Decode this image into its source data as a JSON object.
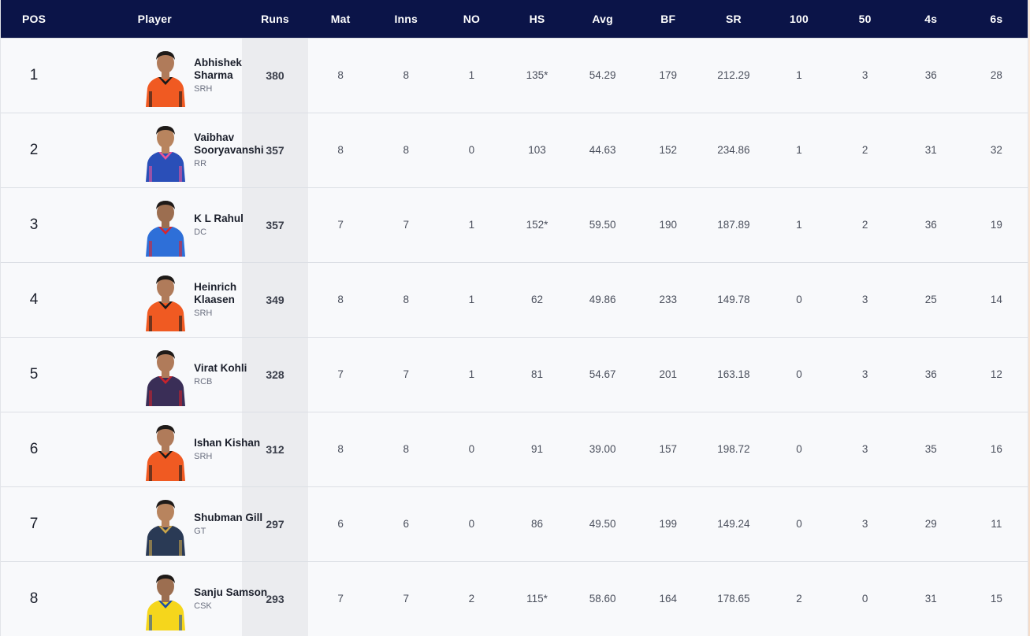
{
  "columns": [
    "POS",
    "Player",
    "Runs",
    "Mat",
    "Inns",
    "NO",
    "HS",
    "Avg",
    "BF",
    "SR",
    "100",
    "50",
    "4s",
    "6s"
  ],
  "team_colors": {
    "SRH": {
      "jersey": "#f05a22",
      "trim": "#1a1a1a",
      "skin": "#b07b5a"
    },
    "RR": {
      "jersey": "#2a4fb8",
      "trim": "#e8559a",
      "skin": "#b8845e"
    },
    "DC": {
      "jersey": "#2e6fd8",
      "trim": "#d8252f",
      "skin": "#9c6e50"
    },
    "RCB": {
      "jersey": "#3a2e57",
      "trim": "#c8232c",
      "skin": "#b07b5a"
    },
    "GT": {
      "jersey": "#2a3a55",
      "trim": "#c9a44a",
      "skin": "#b8845e"
    },
    "CSK": {
      "jersey": "#f5d61c",
      "trim": "#1f4fa3",
      "skin": "#9c6e50"
    }
  },
  "rows": [
    {
      "pos": "1",
      "name": "Abhishek Sharma",
      "team": "SRH",
      "runs": "380",
      "mat": "8",
      "inns": "8",
      "no": "1",
      "hs": "135*",
      "avg": "54.29",
      "bf": "179",
      "sr": "212.29",
      "hundreds": "1",
      "fifties": "3",
      "fours": "36",
      "sixes": "28",
      "avatar_icon": "player-photo-icon"
    },
    {
      "pos": "2",
      "name": "Vaibhav Sooryavanshi",
      "team": "RR",
      "runs": "357",
      "mat": "8",
      "inns": "8",
      "no": "0",
      "hs": "103",
      "avg": "44.63",
      "bf": "152",
      "sr": "234.86",
      "hundreds": "1",
      "fifties": "2",
      "fours": "31",
      "sixes": "32",
      "avatar_icon": "player-photo-icon"
    },
    {
      "pos": "3",
      "name": "K L Rahul",
      "team": "DC",
      "runs": "357",
      "mat": "7",
      "inns": "7",
      "no": "1",
      "hs": "152*",
      "avg": "59.50",
      "bf": "190",
      "sr": "187.89",
      "hundreds": "1",
      "fifties": "2",
      "fours": "36",
      "sixes": "19",
      "avatar_icon": "player-photo-icon"
    },
    {
      "pos": "4",
      "name": "Heinrich Klaasen",
      "team": "SRH",
      "runs": "349",
      "mat": "8",
      "inns": "8",
      "no": "1",
      "hs": "62",
      "avg": "49.86",
      "bf": "233",
      "sr": "149.78",
      "hundreds": "0",
      "fifties": "3",
      "fours": "25",
      "sixes": "14",
      "avatar_icon": "player-photo-icon"
    },
    {
      "pos": "5",
      "name": "Virat Kohli",
      "team": "RCB",
      "runs": "328",
      "mat": "7",
      "inns": "7",
      "no": "1",
      "hs": "81",
      "avg": "54.67",
      "bf": "201",
      "sr": "163.18",
      "hundreds": "0",
      "fifties": "3",
      "fours": "36",
      "sixes": "12",
      "avatar_icon": "player-photo-icon"
    },
    {
      "pos": "6",
      "name": "Ishan Kishan",
      "team": "SRH",
      "runs": "312",
      "mat": "8",
      "inns": "8",
      "no": "0",
      "hs": "91",
      "avg": "39.00",
      "bf": "157",
      "sr": "198.72",
      "hundreds": "0",
      "fifties": "3",
      "fours": "35",
      "sixes": "16",
      "avatar_icon": "player-photo-icon"
    },
    {
      "pos": "7",
      "name": "Shubman Gill",
      "team": "GT",
      "runs": "297",
      "mat": "6",
      "inns": "6",
      "no": "0",
      "hs": "86",
      "avg": "49.50",
      "bf": "199",
      "sr": "149.24",
      "hundreds": "0",
      "fifties": "3",
      "fours": "29",
      "sixes": "11",
      "avatar_icon": "player-photo-icon"
    },
    {
      "pos": "8",
      "name": "Sanju Samson",
      "team": "CSK",
      "runs": "293",
      "mat": "7",
      "inns": "7",
      "no": "2",
      "hs": "115*",
      "avg": "58.60",
      "bf": "164",
      "sr": "178.65",
      "hundreds": "2",
      "fifties": "0",
      "fours": "31",
      "sixes": "15",
      "avatar_icon": "player-photo-icon"
    }
  ]
}
